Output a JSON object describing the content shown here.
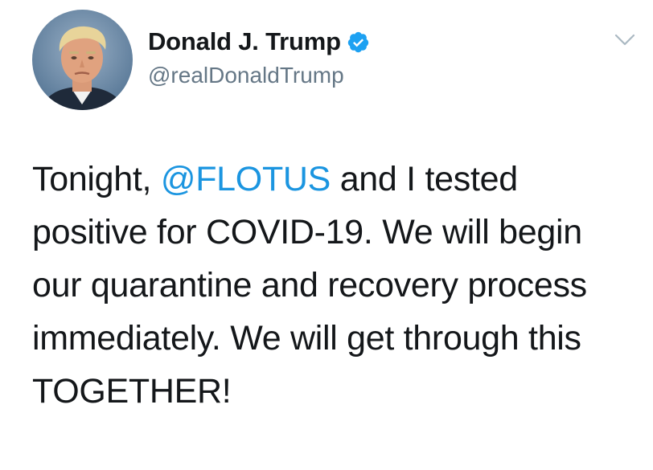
{
  "user": {
    "display_name": "Donald J. Trump",
    "handle": "@realDonaldTrump",
    "verified": true
  },
  "tweet": {
    "text_before_mention": "Tonight, ",
    "mention": "@FLOTUS",
    "text_after_mention": " and I tested positive for COVID-19. We will begin our quarantine and recovery process immediately. We will get through this TOGETHER!"
  },
  "colors": {
    "text": "#14171a",
    "secondary_text": "#657786",
    "link": "#1b95e0",
    "verified_badge": "#1da1f2"
  },
  "icons": {
    "verified": "verified-badge-icon",
    "menu": "chevron-down-icon"
  }
}
